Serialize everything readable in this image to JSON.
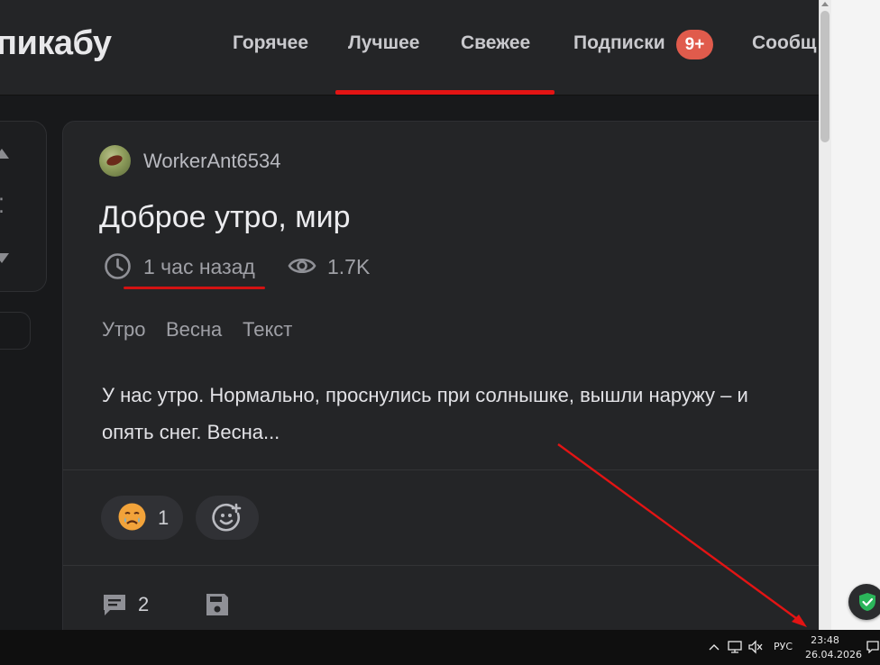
{
  "header": {
    "logo": "пикабу",
    "nav": [
      {
        "label": "Горячее"
      },
      {
        "label": "Лучшее"
      },
      {
        "label": "Свежее"
      },
      {
        "label": "Подписки"
      },
      {
        "label": "Сообщ"
      }
    ],
    "subscriptions_badge": "9+"
  },
  "post": {
    "author": "WorkerAnt6534",
    "title": "Доброе утро, мир",
    "time": "1 час назад",
    "views": "1.7K",
    "tags": [
      "Утро",
      "Весна",
      "Текст"
    ],
    "body_line1": "У нас утро. Нормально, проснулись при солнышке, вышли наружу – и",
    "body_line2": "опять снег. Весна...",
    "reaction_count": "1",
    "comment_count": "2"
  },
  "taskbar": {
    "language": "РУС",
    "time": "23:48",
    "date": "26.04.2026"
  },
  "colors": {
    "accent_red": "#e31414",
    "badge": "#e05b4c",
    "background": "#18191b",
    "card": "#242527",
    "shield_green": "#2bb55a"
  }
}
